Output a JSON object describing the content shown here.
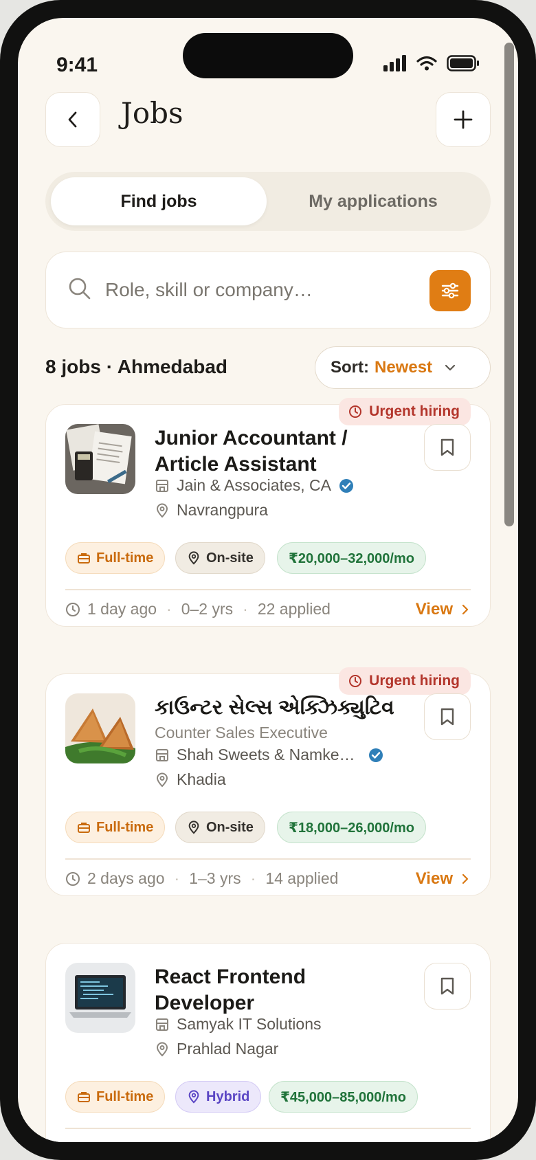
{
  "status": {
    "time": "9:41"
  },
  "header": {
    "title": "Jobs"
  },
  "tabs": [
    {
      "label": "Find jobs",
      "active": true
    },
    {
      "label": "My applications",
      "active": false
    }
  ],
  "search": {
    "placeholder": "Role, skill or company…",
    "value": ""
  },
  "results": {
    "summary": "8 jobs · Ahmedabad",
    "sort_label": "Sort:",
    "sort_value": "Newest"
  },
  "jobs": [
    {
      "urgent": "Urgent hiring",
      "title": "Junior Accountant / Article Assistant",
      "company": "Jain & Associates, CA",
      "location": "Navrangpura",
      "type": "Full-time",
      "mode": "On-site",
      "salary": "₹20,000–32,000/mo",
      "posted": "1 day ago",
      "experience": "0–2 yrs",
      "applied": "22 applied",
      "view": "View"
    },
    {
      "urgent": "Urgent hiring",
      "title": "કાઉન્ટર સેલ્સ એક્ઝિક્યુટિવ",
      "subtitle": "Counter Sales Executive",
      "company": "Shah Sweets & Namke…",
      "location": "Khadia",
      "type": "Full-time",
      "mode": "On-site",
      "salary": "₹18,000–26,000/mo",
      "posted": "2 days ago",
      "experience": "1–3 yrs",
      "applied": "14 applied",
      "view": "View"
    },
    {
      "title": "React Frontend Developer",
      "company": "Samyak IT Solutions",
      "location": "Prahlad Nagar",
      "type": "Full-time",
      "mode": "Hybrid",
      "salary": "₹45,000–85,000/mo"
    }
  ],
  "colors": {
    "accent": "#e07d14",
    "urgent": "#b3352b",
    "salary": "#20733a",
    "hybrid": "#5a45c4",
    "background": "#faf6ef"
  }
}
